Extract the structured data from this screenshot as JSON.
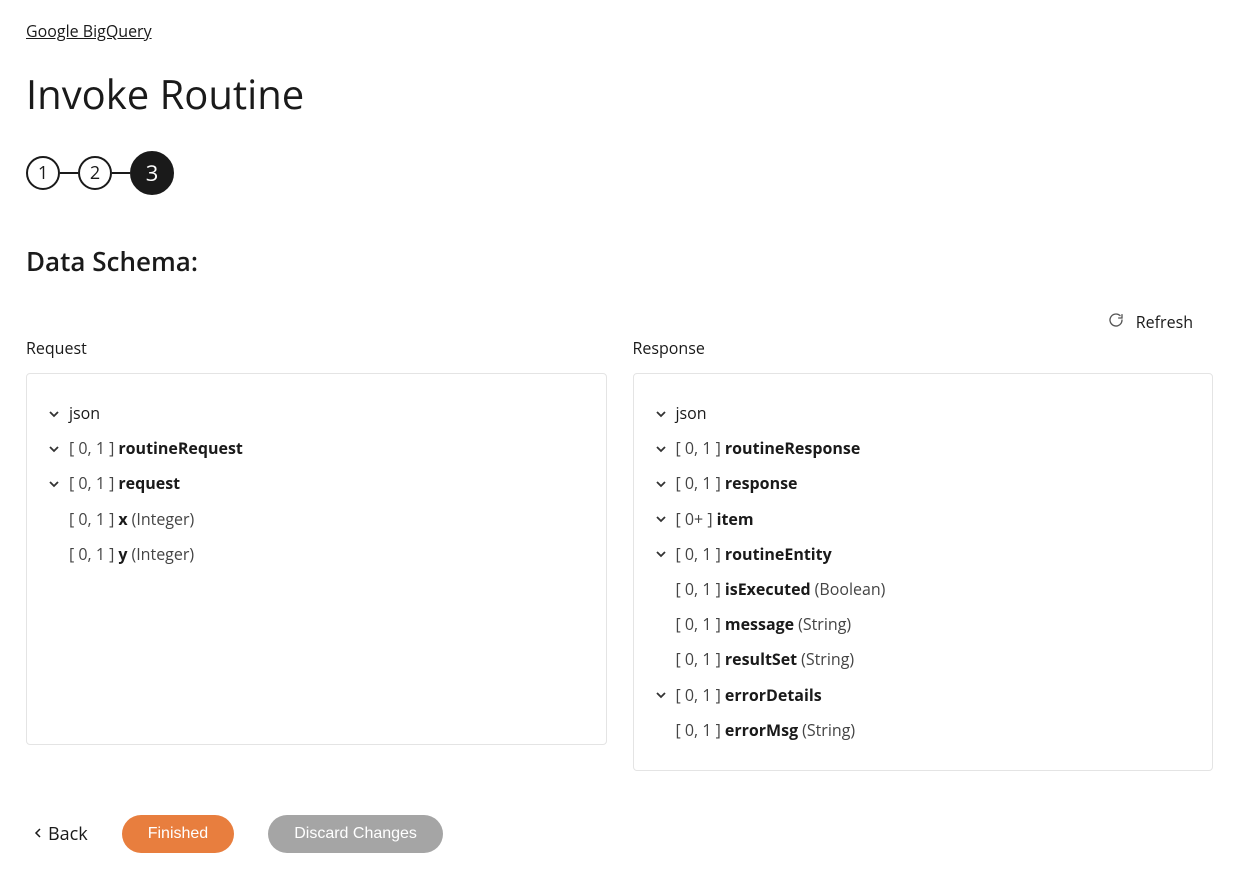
{
  "breadcrumb": "Google BigQuery",
  "title": "Invoke Routine",
  "stepper": {
    "steps": [
      "1",
      "2",
      "3"
    ],
    "active_index": 2
  },
  "section_title": "Data Schema:",
  "refresh_label": "Refresh",
  "columns": {
    "request": {
      "label": "Request",
      "root": "json",
      "rows": [
        {
          "card": "[ 0, 1 ]",
          "name": "routineRequest",
          "indent": 1,
          "expandable": true
        },
        {
          "card": "[ 0, 1 ]",
          "name": "request",
          "indent": 2,
          "expandable": true
        },
        {
          "card": "[ 0, 1 ]",
          "name": "x",
          "type": "(Integer)",
          "indent": 3,
          "expandable": false
        },
        {
          "card": "[ 0, 1 ]",
          "name": "y",
          "type": "(Integer)",
          "indent": 3,
          "expandable": false
        }
      ]
    },
    "response": {
      "label": "Response",
      "root": "json",
      "rows": [
        {
          "card": "[ 0, 1 ]",
          "name": "routineResponse",
          "indent": 1,
          "expandable": true
        },
        {
          "card": "[ 0, 1 ]",
          "name": "response",
          "indent": 2,
          "expandable": true
        },
        {
          "card": "[ 0+ ]",
          "name": "item",
          "indent": 3,
          "expandable": true
        },
        {
          "card": "[ 0, 1 ]",
          "name": "routineEntity",
          "indent": 4,
          "expandable": true
        },
        {
          "card": "[ 0, 1 ]",
          "name": "isExecuted",
          "type": "(Boolean)",
          "indent": 5,
          "expandable": false
        },
        {
          "card": "[ 0, 1 ]",
          "name": "message",
          "type": "(String)",
          "indent": 5,
          "expandable": false
        },
        {
          "card": "[ 0, 1 ]",
          "name": "resultSet",
          "type": "(String)",
          "indent": 5,
          "expandable": false
        },
        {
          "card": "[ 0, 1 ]",
          "name": "errorDetails",
          "indent": 5,
          "expandable": true
        },
        {
          "card": "[ 0, 1 ]",
          "name": "errorMsg",
          "type": "(String)",
          "indent": 6,
          "expandable": false
        }
      ]
    }
  },
  "footer": {
    "back": "Back",
    "finished": "Finished",
    "discard": "Discard Changes"
  }
}
